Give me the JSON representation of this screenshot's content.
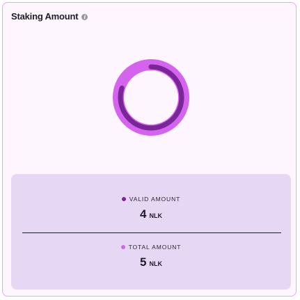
{
  "card": {
    "title": "Staking Amount",
    "info_icon": "info-icon"
  },
  "chart_data": {
    "type": "pie",
    "categories": [
      "Valid Amount",
      "Total Amount"
    ],
    "values": [
      4,
      5
    ],
    "title": "",
    "colors": {
      "valid": "#7a2598",
      "total": "#d463ed"
    }
  },
  "stats": {
    "valid": {
      "label": "VALID AMOUNT",
      "value": "4",
      "unit": "NLK"
    },
    "total": {
      "label": "TOTAL AMOUNT",
      "value": "5",
      "unit": "NLK"
    }
  },
  "colors": {
    "card_background": "#fdf6fe",
    "card_border": "#e7a7ec",
    "panel_background": "#e6d7f5",
    "text": "#1d1b2c"
  }
}
